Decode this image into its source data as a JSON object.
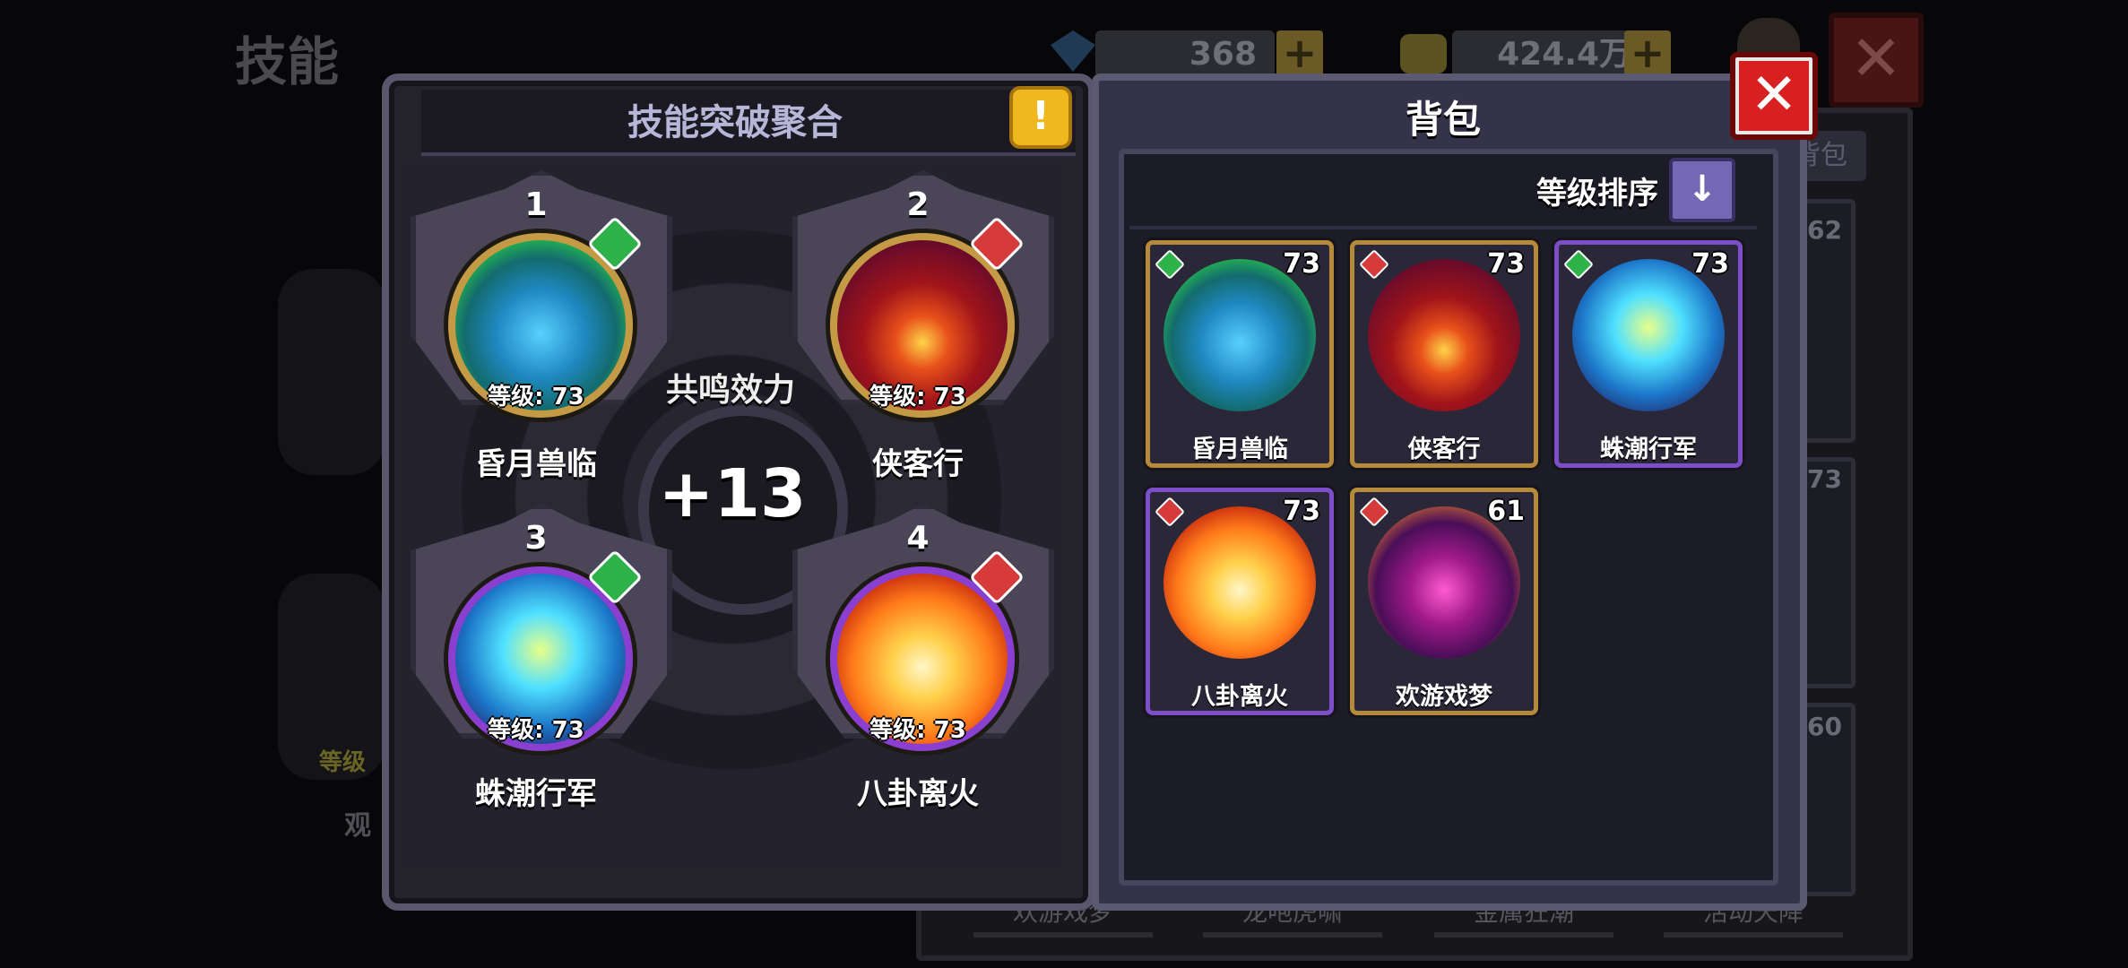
{
  "background": {
    "page_title": "技能",
    "gems": "368",
    "coins": "424.4万",
    "plus": "+",
    "close": "✕",
    "tab_label": "背包",
    "bottom_labels": [
      "欢游戏梦",
      "龙咆虎啸",
      "金属狂潮",
      "活动天降"
    ],
    "side_levels": [
      "62",
      "73",
      "60"
    ],
    "left_ghost_labels": [
      "等级",
      "观"
    ]
  },
  "fusion": {
    "title": "技能突破聚合",
    "warn_icon": "!",
    "resonance_label": "共鸣效力",
    "resonance_value": "+13",
    "slots": [
      {
        "index": "1",
        "level": "等级: 73",
        "name": "昏月兽临",
        "element": "green"
      },
      {
        "index": "2",
        "level": "等级: 73",
        "name": "侠客行",
        "element": "red"
      },
      {
        "index": "3",
        "level": "等级: 73",
        "name": "蛛潮行军",
        "element": "green"
      },
      {
        "index": "4",
        "level": "等级: 73",
        "name": "八卦离火",
        "element": "red"
      }
    ]
  },
  "backpack": {
    "title": "背包",
    "sort_label": "等级排序",
    "sort_icon": "↓",
    "close": "✕",
    "items": [
      {
        "name": "昏月兽临",
        "level": "73",
        "element": "green",
        "rarity": "gold"
      },
      {
        "name": "侠客行",
        "level": "73",
        "element": "red",
        "rarity": "gold"
      },
      {
        "name": "蛛潮行军",
        "level": "73",
        "element": "green",
        "rarity": "purple"
      },
      {
        "name": "八卦离火",
        "level": "73",
        "element": "red",
        "rarity": "purple"
      },
      {
        "name": "欢游戏梦",
        "level": "61",
        "element": "red",
        "rarity": "gold"
      }
    ]
  }
}
